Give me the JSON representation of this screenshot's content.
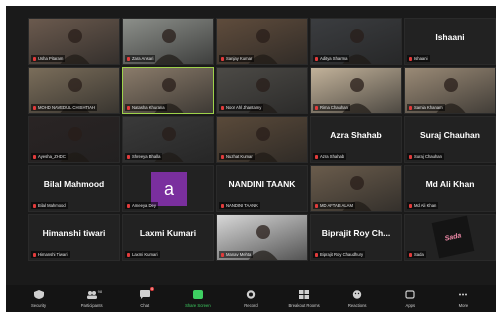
{
  "participants": [
    {
      "label": "Usha Pitaram",
      "video": true,
      "bg": "#6b5a4e"
    },
    {
      "label": "Zara Ansari",
      "video": true,
      "bg": "#8c8f8a"
    },
    {
      "label": "Sanjay Kumar",
      "video": true,
      "bg": "#5f4c3c"
    },
    {
      "label": "Aditya Sharma",
      "video": true,
      "bg": "#3b3d40"
    },
    {
      "label": "Ishaani",
      "display_name": "Ishaani",
      "video": false
    },
    {
      "label": "MOHD NAVEDUL CHISHTIAH",
      "video": true,
      "bg": "#7a6d5a"
    },
    {
      "label": "Natasha Khurana",
      "video": true,
      "bg": "#8a7b6a",
      "active": true
    },
    {
      "label": "Noor Ahl Jhantamy",
      "video": true,
      "bg": "#4c4a46"
    },
    {
      "label": "Rima Chauhan",
      "video": true,
      "bg": "#c2b29a"
    },
    {
      "label": "Samia Khanam",
      "video": true,
      "bg": "#9a8a76"
    },
    {
      "label": "Ayesha_ZHDC",
      "video": true,
      "bg": "#2a2424"
    },
    {
      "label": "Shreeya Bhalla",
      "video": true,
      "bg": "#3a3a3a"
    },
    {
      "label": "Nuzhat Kumar",
      "video": true,
      "bg": "#5a4a3a"
    },
    {
      "label": "Azra Shahab",
      "display_name": "Azra Shahab",
      "video": false
    },
    {
      "label": "Suraj Chauhan",
      "display_name": "Suraj Chauhan",
      "video": false
    },
    {
      "label": "Bilal Mahmood",
      "display_name": "Bilal Mahmood",
      "video": false
    },
    {
      "label": "Ameeya Dey",
      "avatar_letter": "a",
      "video": false
    },
    {
      "label": "NANDINI TAANK",
      "display_name": "NANDINI TAANK",
      "video": false
    },
    {
      "label": "MD AFTAB ALAM",
      "video": true,
      "bg": "#6a5c4c"
    },
    {
      "label": "Md Ali Khan",
      "display_name": "Md Ali Khan",
      "video": false
    },
    {
      "label": "Himanshi Tiwari",
      "display_name": "Himanshi tiwari",
      "video": false
    },
    {
      "label": "Laxmi Kumari",
      "display_name": "Laxmi Kumari",
      "video": false
    },
    {
      "label": "Manav Mehta",
      "video": true,
      "bg": "#d8d8d8"
    },
    {
      "label": "Biprajit Roy Chaudhury",
      "display_name": "Biprajit Roy Ch...",
      "video": false
    },
    {
      "label": "Sada",
      "logo_text": "Sada",
      "video": false
    }
  ],
  "toolbar": [
    {
      "label": "Security",
      "icon": "shield-icon"
    },
    {
      "label": "Participants",
      "icon": "participants-icon",
      "count": "98"
    },
    {
      "label": "Chat",
      "icon": "chat-icon",
      "badge": "4"
    },
    {
      "label": "Share Screen",
      "icon": "share-screen-icon",
      "green": true
    },
    {
      "label": "Record",
      "icon": "record-icon"
    },
    {
      "label": "Breakout Rooms",
      "icon": "breakout-rooms-icon"
    },
    {
      "label": "Reactions",
      "icon": "reactions-icon"
    },
    {
      "label": "Apps",
      "icon": "apps-icon"
    },
    {
      "label": "More",
      "icon": "more-icon"
    }
  ]
}
